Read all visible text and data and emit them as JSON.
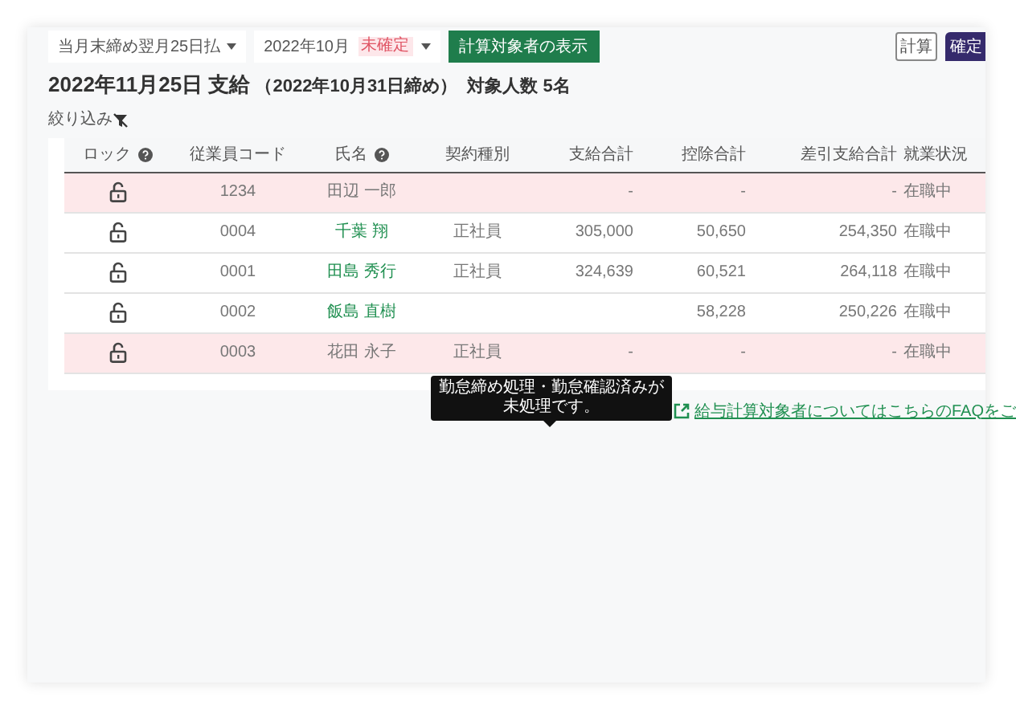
{
  "toolbar": {
    "pay_rule": "当月末締め翌月25日払",
    "month": "2022年10月",
    "month_status": "未確定",
    "show_button": "計算対象者の表示",
    "calc_button": "計算",
    "confirm_button": "確定"
  },
  "heading": {
    "title": "2022年11月25日 支給",
    "period": "（2022年10月31日締め）",
    "count": "対象人数 5名"
  },
  "filter": {
    "label": "絞り込み"
  },
  "table": {
    "columns": [
      "ロック",
      "従業員コード",
      "氏名",
      "契約種別",
      "支給合計",
      "控除合計",
      "差引支給合計",
      "就業状況"
    ],
    "rows": [
      {
        "alert": true,
        "code": "1234",
        "name": "田辺 一郎",
        "pay": "-",
        "deduction": "-",
        "net": "-",
        "status": "在職中"
      },
      {
        "alert": false,
        "code": "0004",
        "name": "千葉 翔",
        "contract": "正社員",
        "pay": "305,000",
        "deduction": "50,650",
        "net": "254,350",
        "status": "在職中"
      },
      {
        "alert": false,
        "code": "0001",
        "name": "田島 秀行",
        "contract": "正社員",
        "pay": "324,639",
        "deduction": "60,521",
        "net": "264,118",
        "status": "在職中"
      },
      {
        "alert": false,
        "code": "0002",
        "name": "飯島 直樹",
        "deduction": "58,228",
        "net": "250,226",
        "status": "在職中"
      },
      {
        "alert": true,
        "code": "0003",
        "name": "花田 永子",
        "contract": "正社員",
        "pay": "-",
        "deduction": "-",
        "net": "-",
        "status": "在職中"
      }
    ]
  },
  "tooltip": {
    "text": "勤怠締め処理・勤怠確認済みが未処理です。"
  },
  "faq_link": "給与計算対象者についてはこちらのFAQをご"
}
